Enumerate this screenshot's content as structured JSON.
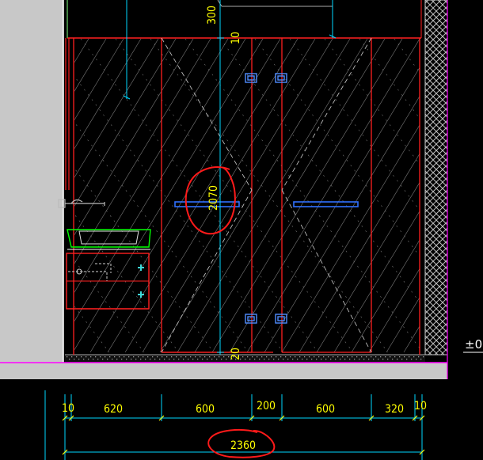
{
  "drawing": {
    "elevation_marker": "±0",
    "vertical_dims": {
      "top_offset": "300",
      "top_small": "10",
      "door_height": "2070",
      "bottom_small": "20"
    },
    "horizontal_dims": [
      "10",
      "620",
      "600",
      "200",
      "600",
      "320",
      "10"
    ],
    "total_width": "2360"
  },
  "colors": {
    "background": "#000000",
    "dimension_text": "#ffff00",
    "outline_red": "#ff2020",
    "axis_cyan": "#00d8ff",
    "hatch_white": "#dcdcdc",
    "annotation_red": "#ff1a1a",
    "wall_magenta": "#ff00ff",
    "floor_gray": "#c8c8c8",
    "sink_green": "#00ff00",
    "handle_blue": "#3070ff"
  }
}
